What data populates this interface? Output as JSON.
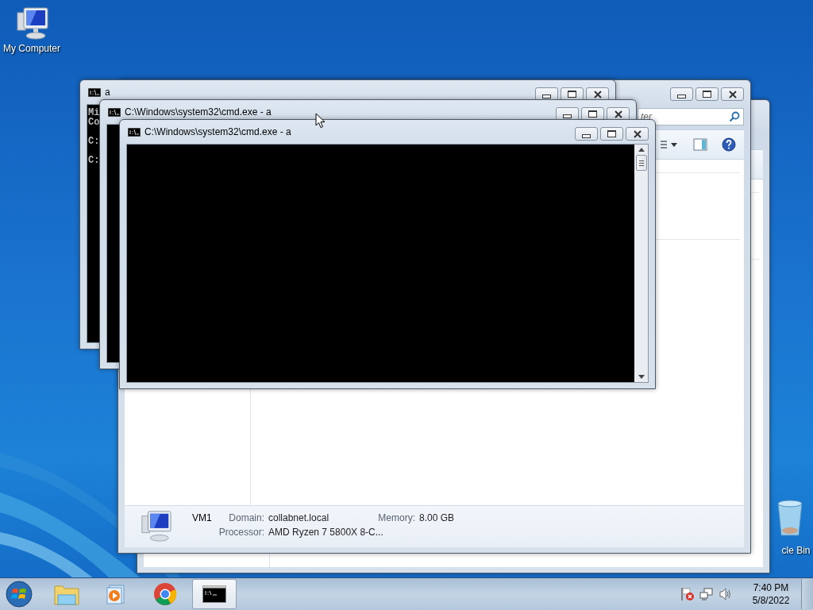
{
  "desktop_icons": [
    {
      "kind": "computer",
      "label": "My Computer"
    },
    {
      "kind": "recycle-bin",
      "label": "cle Bin"
    }
  ],
  "windows": [
    {
      "kind": "explorer"
    },
    {
      "kind": "explorer",
      "search": {
        "placeholder": "ter"
      },
      "details": {
        "name": "VM1",
        "fields": [
          {
            "label": "Domain:",
            "value": "collabnet.local"
          },
          {
            "label": "Memory:",
            "value": "8.00 GB"
          },
          {
            "label": "Processor:",
            "value": "AMD Ryzen 7 5800X 8-C..."
          }
        ]
      }
    },
    {
      "kind": "console",
      "title": "a",
      "output": "Mi\nCo\n\nC:\n\nC:"
    },
    {
      "kind": "console",
      "title": "C:\\Windows\\system32\\cmd.exe - a"
    },
    {
      "kind": "console",
      "title": "C:\\Windows\\system32\\cmd.exe - a",
      "scrollbar": true
    }
  ],
  "taskbar": {
    "items": [
      {
        "kind": "start",
        "selected": false
      },
      {
        "kind": "explorer",
        "selected": false
      },
      {
        "kind": "media",
        "selected": false
      },
      {
        "kind": "browser",
        "selected": false
      },
      {
        "kind": "console",
        "selected": true
      }
    ],
    "tray": {
      "time": "7:40 PM",
      "date": "5/8/2022"
    }
  }
}
